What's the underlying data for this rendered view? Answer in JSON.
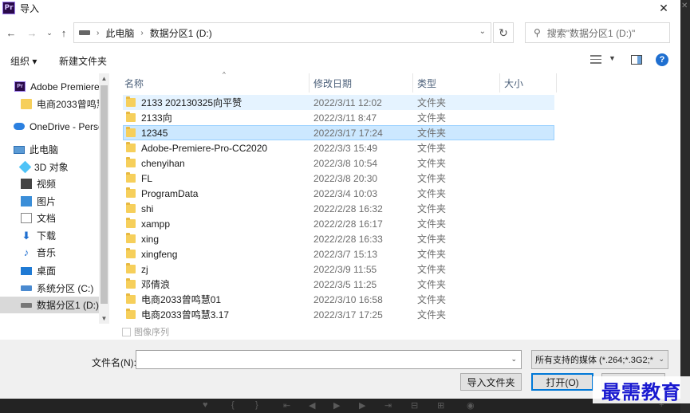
{
  "window": {
    "title": "导入",
    "app_icon": "Pr",
    "close": "✕"
  },
  "nav": {
    "back": "←",
    "forward": "→",
    "recent": "⌄",
    "up": "↑"
  },
  "address": {
    "crumbs": [
      "此电脑",
      "数据分区1 (D:)"
    ],
    "separator": "›"
  },
  "search": {
    "placeholder": "搜索\"数据分区1 (D:)\""
  },
  "toolbar": {
    "organize": "组织 ▾",
    "new_folder": "新建文件夹",
    "help": "?"
  },
  "sidebar": {
    "items": [
      {
        "label": "Adobe Premiere",
        "icon": "premiere-icon",
        "icon_text": "Pr"
      },
      {
        "label": "电商2033曾鸣慧",
        "icon": "folder-icon"
      },
      {
        "label": "OneDrive - Perso",
        "icon": "onedrive-icon"
      },
      {
        "label": "此电脑",
        "icon": "this-pc-icon"
      },
      {
        "label": "3D 对象",
        "icon": "3d-objects-icon"
      },
      {
        "label": "视频",
        "icon": "videos-icon"
      },
      {
        "label": "图片",
        "icon": "pictures-icon"
      },
      {
        "label": "文档",
        "icon": "documents-icon"
      },
      {
        "label": "下载",
        "icon": "downloads-icon",
        "glyph": "⬇"
      },
      {
        "label": "音乐",
        "icon": "music-icon",
        "glyph": "♪"
      },
      {
        "label": "桌面",
        "icon": "desktop-icon"
      },
      {
        "label": "系统分区 (C:)",
        "icon": "system-drive-icon"
      },
      {
        "label": "数据分区1 (D:)",
        "icon": "data-drive-icon"
      }
    ]
  },
  "columns": {
    "name": "名称",
    "modified": "修改日期",
    "type": "类型",
    "size": "大小"
  },
  "files": [
    {
      "name": "2133  202130325向平赞",
      "modified": "2022/3/11 12:02",
      "type": "文件夹"
    },
    {
      "name": "2133向",
      "modified": "2022/3/11 8:47",
      "type": "文件夹"
    },
    {
      "name": "12345",
      "modified": "2022/3/17 17:24",
      "type": "文件夹"
    },
    {
      "name": "Adobe-Premiere-Pro-CC2020",
      "modified": "2022/3/3 15:49",
      "type": "文件夹"
    },
    {
      "name": "chenyihan",
      "modified": "2022/3/8 10:54",
      "type": "文件夹"
    },
    {
      "name": "FL",
      "modified": "2022/3/8 20:30",
      "type": "文件夹"
    },
    {
      "name": "ProgramData",
      "modified": "2022/3/4 10:03",
      "type": "文件夹"
    },
    {
      "name": "shi",
      "modified": "2022/2/28 16:32",
      "type": "文件夹"
    },
    {
      "name": "xampp",
      "modified": "2022/2/28 16:17",
      "type": "文件夹"
    },
    {
      "name": "xing",
      "modified": "2022/2/28 16:33",
      "type": "文件夹"
    },
    {
      "name": "xingfeng",
      "modified": "2022/3/7 15:13",
      "type": "文件夹"
    },
    {
      "name": "zj",
      "modified": "2022/3/9 11:55",
      "type": "文件夹"
    },
    {
      "name": "邓倩浪",
      "modified": "2022/3/5 11:25",
      "type": "文件夹"
    },
    {
      "name": "电商2033曾鸣慧01",
      "modified": "2022/3/10 16:58",
      "type": "文件夹"
    },
    {
      "name": "电商2033曾鸣慧3.17",
      "modified": "2022/3/17 17:25",
      "type": "文件夹"
    }
  ],
  "image_sequence": {
    "label": "图像序列"
  },
  "filename": {
    "label": "文件名(N):",
    "value": ""
  },
  "filetype": {
    "selected": "所有支持的媒体 (*.264;*.3G2;*"
  },
  "buttons": {
    "import_folder": "导入文件夹",
    "open": "打开(O)"
  },
  "watermark": "最需教育",
  "colors": {
    "selected_row": "#cce8ff",
    "hover_row": "#e5f3ff",
    "accent": "#0078d7",
    "folder": "#f6cf5b"
  }
}
